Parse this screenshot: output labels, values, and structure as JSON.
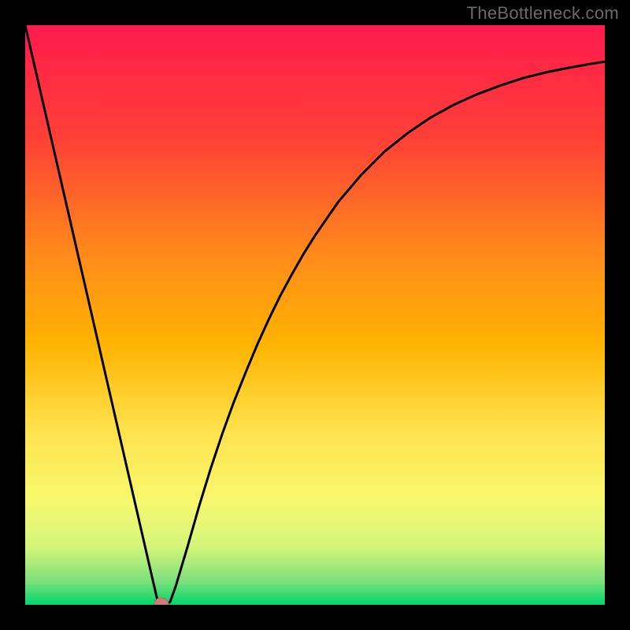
{
  "watermark": "TheBottleneck.com",
  "chart_data": {
    "type": "line",
    "title": "",
    "xlabel": "",
    "ylabel": "",
    "xlim": [
      0,
      100
    ],
    "ylim": [
      0,
      100
    ],
    "series": [
      {
        "name": "curve",
        "x": [
          0,
          2,
          4,
          6,
          8,
          10,
          12,
          14,
          16,
          18,
          20,
          22,
          23,
          24,
          25,
          26,
          28,
          30,
          32,
          34,
          36,
          38,
          40,
          42,
          44,
          46,
          48,
          50,
          54,
          58,
          62,
          66,
          70,
          74,
          78,
          82,
          86,
          90,
          94,
          98,
          100
        ],
        "y": [
          100,
          91.3,
          82.6,
          73.9,
          65.2,
          56.5,
          47.8,
          39.1,
          30.4,
          21.7,
          13.0,
          4.3,
          0.0,
          0.0,
          0.5,
          3.3,
          10.0,
          17.0,
          23.5,
          29.5,
          35.0,
          40.0,
          44.8,
          49.2,
          53.3,
          57.0,
          60.5,
          63.7,
          69.5,
          74.2,
          78.2,
          81.4,
          84.1,
          86.3,
          88.1,
          89.6,
          90.9,
          91.9,
          92.7,
          93.4,
          93.7
        ]
      }
    ],
    "minimum_marker": {
      "x": 23.5,
      "y": 0.0
    },
    "gradient_stops": [
      {
        "offset": 0.0,
        "color": "#ff1a4d"
      },
      {
        "offset": 0.2,
        "color": "#ff4136"
      },
      {
        "offset": 0.4,
        "color": "#ff8c1a"
      },
      {
        "offset": 0.55,
        "color": "#ffb300"
      },
      {
        "offset": 0.7,
        "color": "#ffe24d"
      },
      {
        "offset": 0.82,
        "color": "#f8f86e"
      },
      {
        "offset": 0.9,
        "color": "#d4f57a"
      },
      {
        "offset": 0.96,
        "color": "#7be07b"
      },
      {
        "offset": 1.0,
        "color": "#00d66b"
      }
    ]
  }
}
